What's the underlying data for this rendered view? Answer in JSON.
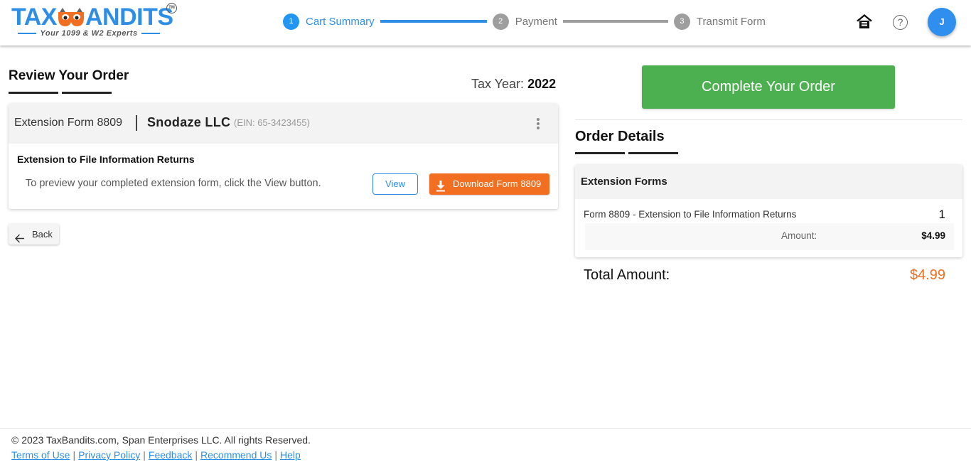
{
  "brand": {
    "name_left": "TAX",
    "name_right": "ANDITS",
    "trademark": "TM",
    "tagline": "Your 1099 & W2 Experts",
    "colors": {
      "primary": "#2e8ee6",
      "mask": "#f26e21"
    }
  },
  "steps": [
    {
      "number": "1",
      "label": "Cart Summary",
      "active": true
    },
    {
      "number": "2",
      "label": "Payment",
      "active": false
    },
    {
      "number": "3",
      "label": "Transmit Form",
      "active": false
    }
  ],
  "header_icons": {
    "home": "home-icon",
    "help": "?",
    "avatar_initial": "J"
  },
  "review": {
    "title": "Review Your Order",
    "tax_year_label": "Tax Year:",
    "tax_year_value": "2022",
    "form_card": {
      "form_name": "Extension Form 8809",
      "company": "Snodaze LLC",
      "ein": "(EIN: 65-3423455)",
      "subtitle": "Extension to File Information Returns",
      "description": "To preview your completed extension form, click the View button.",
      "view_label": "View",
      "download_label": "Download Form 8809"
    },
    "back_label": "Back"
  },
  "order": {
    "complete_label": "Complete Your Order",
    "title": "Order Details",
    "section_label": "Extension Forms",
    "item_label": "Form 8809 - Extension to File Information Returns",
    "item_qty": "1",
    "amount_label": "Amount:",
    "amount_value": "$4.99",
    "total_label": "Total Amount:",
    "total_value": "$4.99",
    "colors": {
      "complete": "#4caf50",
      "total": "#f26e21",
      "download": "#f26e21"
    }
  },
  "footer": {
    "copyright": "© 2023 TaxBandits.com, Span Enterprises LLC. All rights Reserved.",
    "links": [
      "Terms of Use",
      "Privacy Policy",
      "Feedback",
      "Recommend Us",
      "Help"
    ],
    "separator": "|"
  }
}
